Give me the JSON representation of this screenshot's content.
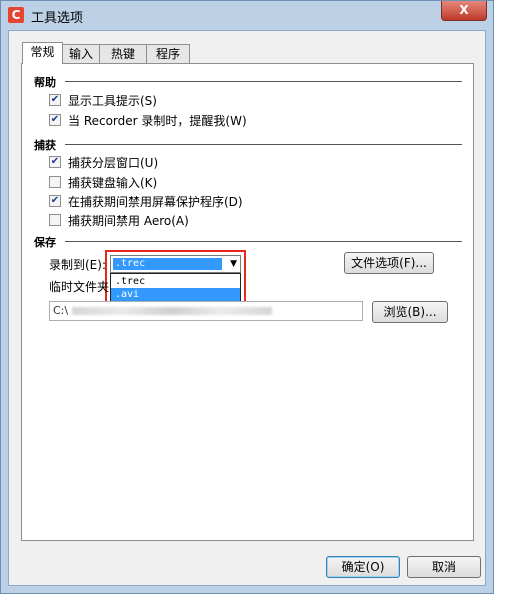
{
  "window": {
    "title": "工具选项",
    "app_icon_letter": "C",
    "close_label": "X"
  },
  "tabs": [
    {
      "label": "常规",
      "active": true
    },
    {
      "label": "输入",
      "active": false
    },
    {
      "label": "热键",
      "active": false
    },
    {
      "label": "程序",
      "active": false
    }
  ],
  "help": {
    "heading": "帮助",
    "items": [
      {
        "label": "显示工具提示(S)",
        "checked": true
      },
      {
        "label": "当 Recorder 录制时，提醒我(W)",
        "checked": true
      }
    ]
  },
  "capture": {
    "heading": "捕获",
    "items": [
      {
        "label": "捕获分层窗口(U)",
        "checked": true
      },
      {
        "label": "捕获键盘输入(K)",
        "checked": false
      },
      {
        "label": "在捕获期间禁用屏幕保护程序(D)",
        "checked": true
      },
      {
        "label": "捕获期间禁用 Aero(A)",
        "checked": false
      }
    ]
  },
  "save": {
    "heading": "保存",
    "record_to_label": "录制到(E):",
    "record_to_value": ".trec",
    "dropdown_options": [
      ".trec",
      ".avi"
    ],
    "dropdown_highlighted": ".avi",
    "file_options_button": "文件选项(F)...",
    "temp_folder_label": "临时文件夹",
    "temp_folder_value": "C:\\",
    "browse_button": "浏览(B)..."
  },
  "footer": {
    "ok_button": "确定(O)",
    "cancel_button": "取消"
  },
  "colors": {
    "highlight_border": "#e8271c",
    "selection": "#3399ff",
    "app_icon": "#e64431"
  }
}
